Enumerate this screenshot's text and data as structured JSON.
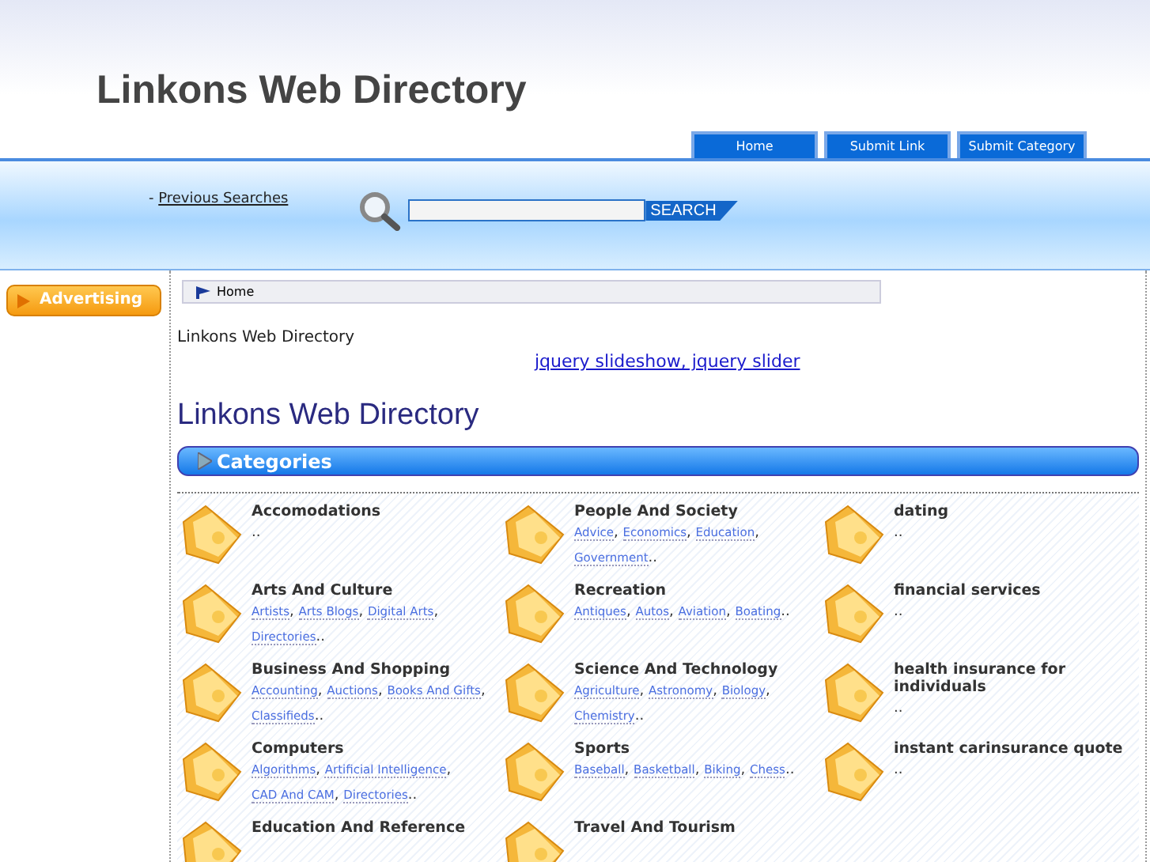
{
  "site_title": "Linkons Web Directory",
  "nav_tabs": [
    {
      "label": "Home"
    },
    {
      "label": "Submit Link"
    },
    {
      "label": "Submit Category"
    }
  ],
  "search": {
    "prefix": "-",
    "previous_searches": "Previous Searches",
    "button": "SEARCH"
  },
  "sidebar": {
    "advertising": "Advertising"
  },
  "breadcrumb": "Home",
  "intro_text": "Linkons Web Directory",
  "promo_link": "jquery slideshow, jquery slider",
  "heading": "Linkons Web Directory",
  "categories_bar": "Categories",
  "separator": ",",
  "category_columns": [
    [
      {
        "name": "Accomodations",
        "more": ".."
      },
      {
        "name": "Arts And Culture",
        "subs": [
          "Artists",
          "Arts Blogs",
          "Digital Arts",
          "Directories"
        ],
        "more": ".."
      },
      {
        "name": "Business And Shopping",
        "subs": [
          "Accounting",
          "Auctions",
          "Books And Gifts",
          "Classifieds"
        ],
        "more": ".."
      },
      {
        "name": "Computers",
        "subs": [
          "Algorithms",
          "Artificial Intelligence",
          "CAD And CAM",
          "Directories"
        ],
        "more": ".."
      },
      {
        "name": "Education And Reference"
      }
    ],
    [
      {
        "name": "People And Society",
        "subs": [
          "Advice",
          "Economics",
          "Education",
          "Government"
        ],
        "more": ".."
      },
      {
        "name": "Recreation",
        "subs": [
          "Antiques",
          "Autos",
          "Aviation",
          "Boating"
        ],
        "more": ".."
      },
      {
        "name": "Science And Technology",
        "subs": [
          "Agriculture",
          "Astronomy",
          "Biology",
          "Chemistry"
        ],
        "more": ".."
      },
      {
        "name": "Sports",
        "subs": [
          "Baseball",
          "Basketball",
          "Biking",
          "Chess"
        ],
        "more": ".."
      },
      {
        "name": "Travel And Tourism"
      }
    ],
    [
      {
        "name": "dating",
        "more": ".."
      },
      {
        "name": "financial services",
        "more": ".."
      },
      {
        "name": "health insurance for individuals",
        "more": ".."
      },
      {
        "name": "instant carinsurance quote",
        "more": ".."
      }
    ]
  ]
}
